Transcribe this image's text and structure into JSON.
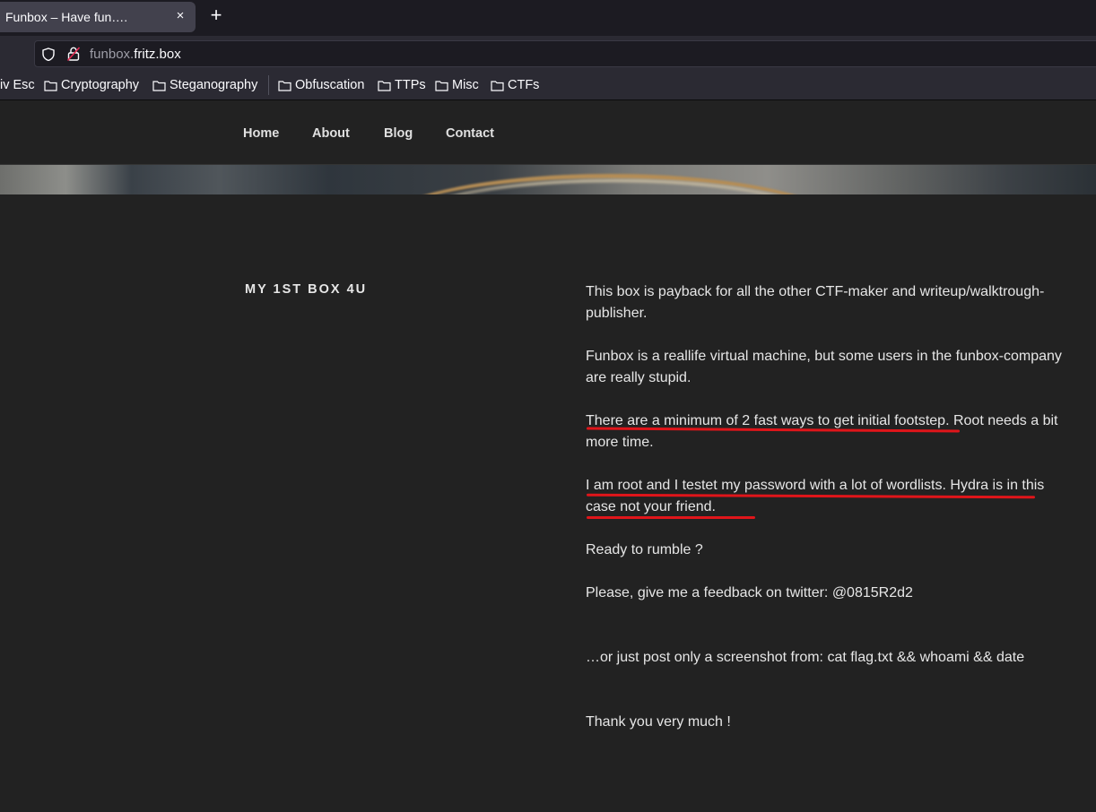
{
  "browser": {
    "tab_title": "Funbox – Have fun….",
    "tab_close": "×",
    "new_tab": "+",
    "url_sub": "funbox.",
    "url_domain": "fritz.box",
    "bookmarks": [
      "iv Esc",
      "Cryptography",
      "Steganography",
      "Obfuscation",
      "TTPs",
      "Misc",
      "CTFs"
    ]
  },
  "site": {
    "menu": [
      "Home",
      "About",
      "Blog",
      "Contact"
    ],
    "section_title": "MY 1ST BOX 4U",
    "paragraphs": [
      "This box is payback for all the other CTF-maker and writeup/walktrough-publisher.",
      "Funbox is a reallife virtual machine, but some users in the funbox-company are really stupid.",
      "There are a minimum of 2 fast ways to get initial footstep. Root needs a bit more time.",
      "I am root and I testet my password with a lot of wordlists. Hydra is in this case not your friend.",
      "Ready to rumble ?",
      "Please, give me a feedback on twitter: @0815R2d2",
      "…or just post only a screenshot from: cat flag.txt && whoami && date",
      "Thank you very much !"
    ]
  },
  "colors": {
    "annotation": "#e0151a",
    "page_bg": "#222222"
  }
}
